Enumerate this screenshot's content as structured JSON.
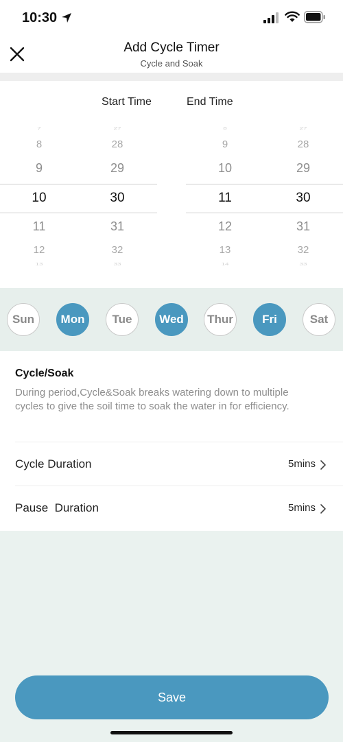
{
  "status_bar": {
    "time": "10:30"
  },
  "header": {
    "title": "Add Cycle Timer",
    "subtitle": "Cycle and Soak"
  },
  "picker": {
    "start_label": "Start Time",
    "end_label": "End Time",
    "start_hour": {
      "above": [
        "7",
        "8",
        "9"
      ],
      "selected": "10",
      "below": [
        "11",
        "12",
        "13"
      ]
    },
    "start_minute": {
      "above": [
        "27",
        "28",
        "29"
      ],
      "selected": "30",
      "below": [
        "31",
        "32",
        "33"
      ]
    },
    "end_hour": {
      "above": [
        "8",
        "9",
        "10"
      ],
      "selected": "11",
      "below": [
        "12",
        "13",
        "14"
      ]
    },
    "end_minute": {
      "above": [
        "27",
        "28",
        "29"
      ],
      "selected": "30",
      "below": [
        "31",
        "32",
        "33"
      ]
    }
  },
  "days": [
    {
      "label": "Sun",
      "active": false
    },
    {
      "label": "Mon",
      "active": true
    },
    {
      "label": "Tue",
      "active": false
    },
    {
      "label": "Wed",
      "active": true
    },
    {
      "label": "Thur",
      "active": false
    },
    {
      "label": "Fri",
      "active": true
    },
    {
      "label": "Sat",
      "active": false
    }
  ],
  "info": {
    "title": "Cycle/Soak",
    "description": "During period,Cycle&Soak breaks watering down to multiple cycles to give the soil time to soak the water in for efficiency."
  },
  "settings": [
    {
      "label": "Cycle Duration",
      "value": "5mins"
    },
    {
      "label": "Pause  Duration",
      "value": "5mins"
    }
  ],
  "save_label": "Save",
  "colors": {
    "accent": "#4a98bf",
    "background": "#eaf2ef"
  }
}
